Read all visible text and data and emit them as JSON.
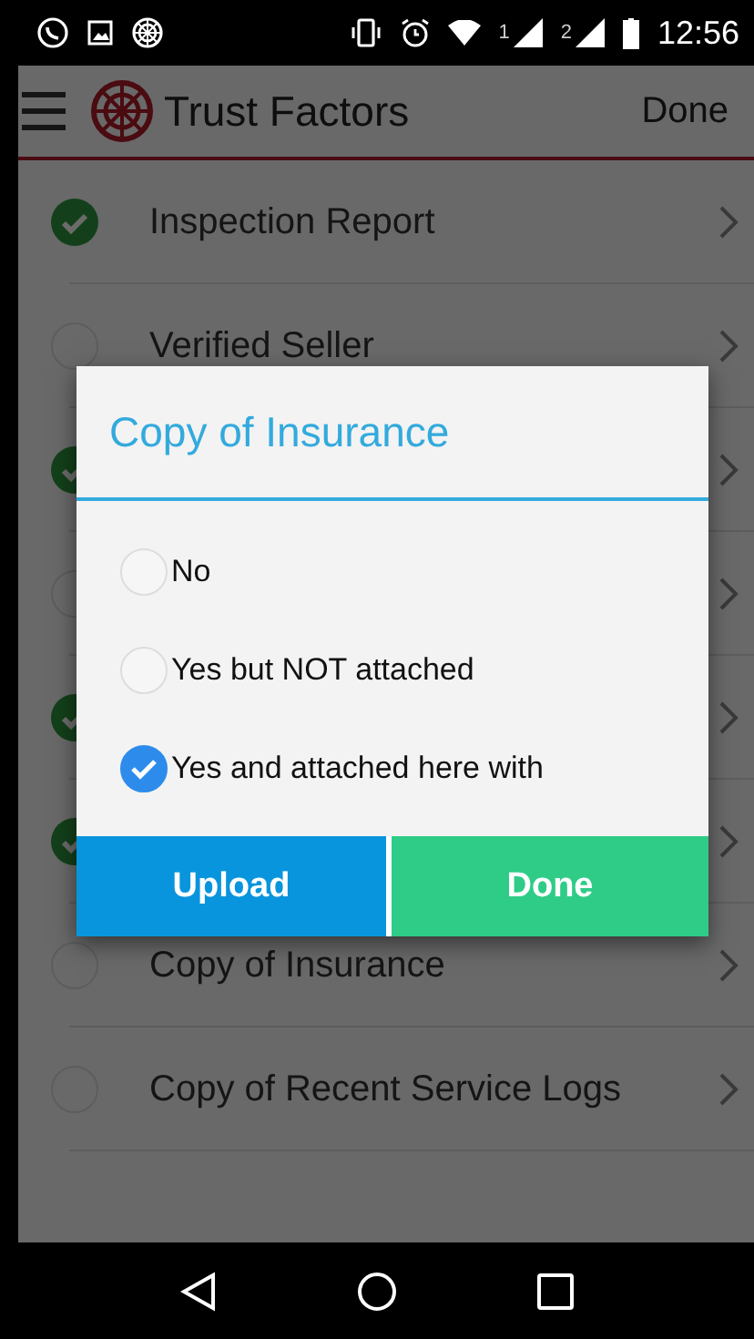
{
  "status_bar": {
    "time": "12:56",
    "sim_1": "1",
    "sim_2": "2"
  },
  "app_bar": {
    "title": "Trust Factors",
    "action": "Done"
  },
  "rows": [
    {
      "label": "Inspection Report",
      "checked": true
    },
    {
      "label": "Verified Seller",
      "checked": false
    },
    {
      "checked": true
    },
    {
      "checked": false
    },
    {
      "checked": true
    },
    {
      "checked": true
    },
    {
      "label": "Copy of Insurance",
      "checked": false
    },
    {
      "label": "Copy of Recent Service Logs",
      "checked": false
    }
  ],
  "dialog": {
    "title": "Copy of Insurance",
    "options": [
      {
        "label": "No",
        "selected": false
      },
      {
        "label": "Yes but NOT attached",
        "selected": false
      },
      {
        "label": "Yes and attached here with",
        "selected": true
      }
    ],
    "buttons": [
      {
        "label": "Upload",
        "kind": "primary"
      },
      {
        "label": "Done",
        "kind": "confirm"
      }
    ]
  }
}
